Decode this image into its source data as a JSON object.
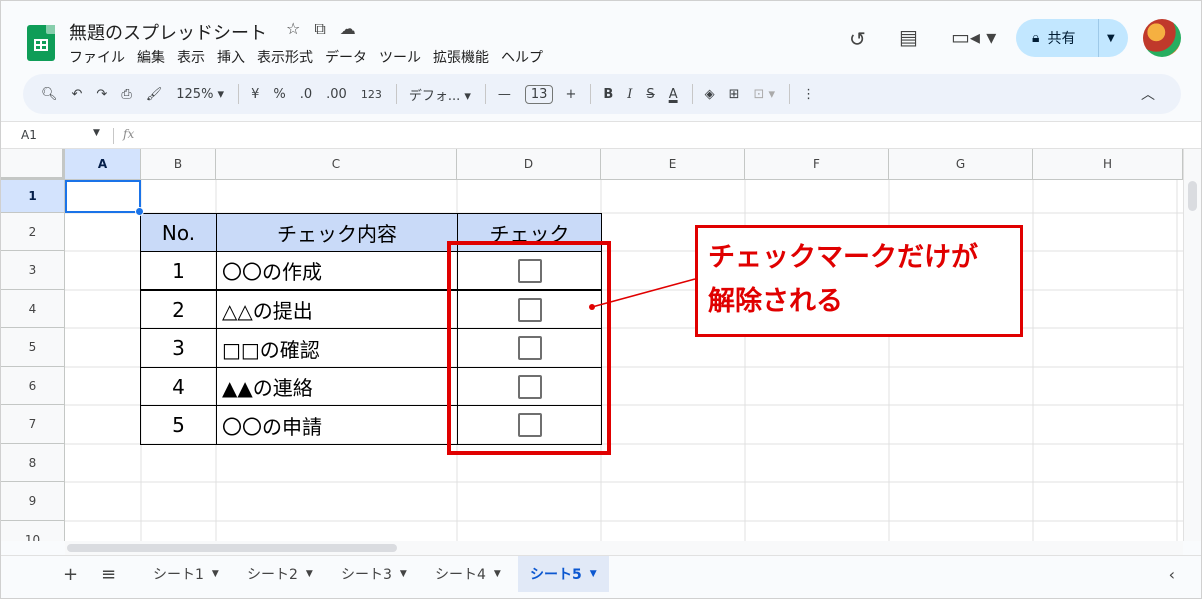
{
  "doc": {
    "title": "無題のスプレッドシート"
  },
  "header_icons": [
    "star-icon",
    "move-to-folder-icon",
    "cloud-status-icon"
  ],
  "menus": [
    "ファイル",
    "編集",
    "表示",
    "挿入",
    "表示形式",
    "データ",
    "ツール",
    "拡張機能",
    "ヘルプ"
  ],
  "share": {
    "label": "共有"
  },
  "toolbar": {
    "zoom": "125%",
    "currency": "¥",
    "percent": "%",
    "dec_decrease": ".0",
    "dec_increase": ".00",
    "format_num": "123",
    "font": "デフォ...",
    "font_size": "13",
    "bold": "B",
    "italic": "I",
    "strike": "S",
    "text_color": "A",
    "more": "⋮"
  },
  "namebox": "A1",
  "fx": "fx",
  "columns": [
    "A",
    "B",
    "C",
    "D",
    "E",
    "F",
    "G",
    "H"
  ],
  "rows": [
    "1",
    "2",
    "3",
    "4",
    "5",
    "6",
    "7",
    "8",
    "9",
    "10"
  ],
  "table": {
    "headers": [
      "No.",
      "チェック内容",
      "チェック"
    ],
    "rows": [
      {
        "no": "1",
        "item": "〇〇の作成"
      },
      {
        "no": "2",
        "item": "△△の提出"
      },
      {
        "no": "3",
        "item": "□□の確認"
      },
      {
        "no": "4",
        "item": "▲▲の連絡"
      },
      {
        "no": "5",
        "item": "〇〇の申請"
      }
    ]
  },
  "callout": {
    "line1": "チェックマークだけが",
    "line2": "解除される",
    "color": "#e00000"
  },
  "sheets": [
    "シート1",
    "シート2",
    "シート3",
    "シート4",
    "シート5"
  ],
  "active_sheet": "シート5",
  "colors": {
    "accent": "#1a73e8",
    "header_fill": "#c9daf8",
    "share_bg": "#c2e7ff"
  }
}
